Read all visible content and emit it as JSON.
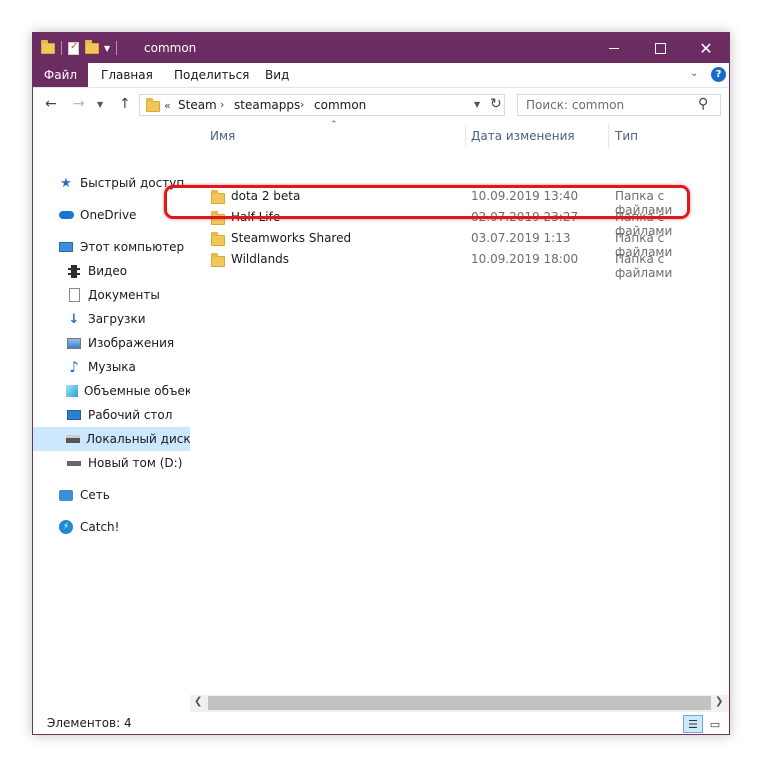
{
  "window": {
    "title": "common",
    "colors": {
      "accent": "#6b2c61",
      "selection": "#cce8ff",
      "highlight": "#e0171d"
    }
  },
  "ribbon": {
    "file_tab": "Файл",
    "tabs": [
      "Главная",
      "Поделиться",
      "Вид"
    ],
    "expand_glyph": "⌄",
    "help_glyph": "?"
  },
  "addressbar": {
    "prefix": "«",
    "crumbs": [
      "Steam",
      "steamapps",
      "common"
    ],
    "separator": "›"
  },
  "search": {
    "placeholder": "Поиск: common"
  },
  "navpane": {
    "items": [
      {
        "label": "Быстрый доступ",
        "icon": "star-icon"
      },
      {
        "label": "OneDrive",
        "icon": "cloud-icon"
      },
      {
        "label": "Этот компьютер",
        "icon": "monitor-icon"
      },
      {
        "label": "Видео",
        "icon": "video-icon"
      },
      {
        "label": "Документы",
        "icon": "document-icon"
      },
      {
        "label": "Загрузки",
        "icon": "download-icon"
      },
      {
        "label": "Изображения",
        "icon": "image-icon"
      },
      {
        "label": "Музыка",
        "icon": "music-icon"
      },
      {
        "label": "Объемные объект",
        "icon": "cube-icon"
      },
      {
        "label": "Рабочий стол",
        "icon": "desktop-icon"
      },
      {
        "label": "Локальный диск (С",
        "icon": "drive-icon"
      },
      {
        "label": "Новый том (D:)",
        "icon": "drive-icon"
      },
      {
        "label": "Сеть",
        "icon": "network-icon"
      },
      {
        "label": "Catch!",
        "icon": "catch-icon"
      }
    ]
  },
  "columns": {
    "name": "Имя",
    "date": "Дата изменения",
    "type": "Тип"
  },
  "files": [
    {
      "name": "dota 2 beta",
      "date": "10.09.2019 13:40",
      "type": "Папка с файлами"
    },
    {
      "name": "Half-Life",
      "date": "02.07.2019 23:27",
      "type": "Папка с файлами"
    },
    {
      "name": "Steamworks Shared",
      "date": "03.07.2019 1:13",
      "type": "Папка с файлами"
    },
    {
      "name": "Wildlands",
      "date": "10.09.2019 18:00",
      "type": "Папка с файлами"
    }
  ],
  "status": {
    "count_text": "Элементов: 4"
  }
}
